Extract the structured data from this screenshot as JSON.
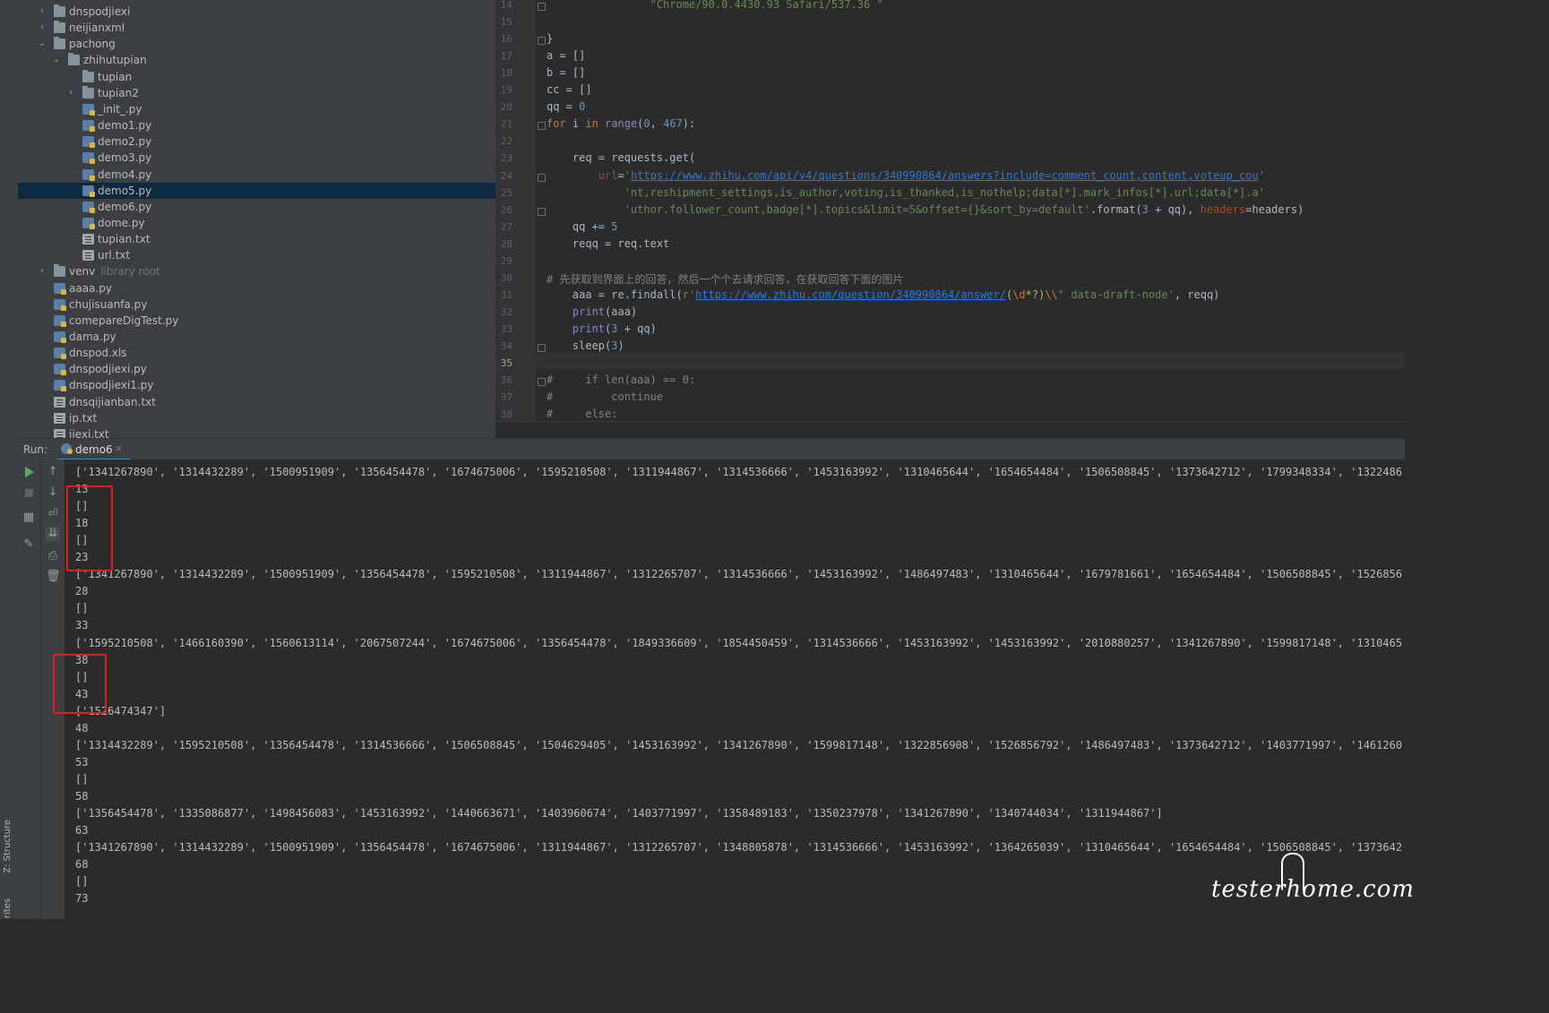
{
  "left_strip": {
    "structure_label": "Z: Structure",
    "favorites_label": "rites"
  },
  "project_tree": [
    {
      "label": "dnspodjiexi",
      "type": "folder",
      "arrow": "right",
      "muted": ""
    },
    {
      "label": "neijianxml",
      "type": "folder",
      "arrow": "right",
      "muted": ""
    },
    {
      "label": "pachong",
      "type": "folder",
      "arrow": "down",
      "muted": ""
    },
    {
      "label": "zhihutupian",
      "type": "folder",
      "arrow": "down",
      "muted": ""
    },
    {
      "label": "tupian",
      "type": "folder",
      "arrow": "",
      "muted": ""
    },
    {
      "label": "tupian2",
      "type": "folder",
      "arrow": "right",
      "muted": ""
    },
    {
      "label": "_init_.py",
      "type": "py",
      "arrow": "",
      "muted": ""
    },
    {
      "label": "demo1.py",
      "type": "py",
      "arrow": "",
      "muted": ""
    },
    {
      "label": "demo2.py",
      "type": "py",
      "arrow": "",
      "muted": ""
    },
    {
      "label": "demo3.py",
      "type": "py",
      "arrow": "",
      "muted": ""
    },
    {
      "label": "demo4.py",
      "type": "py",
      "arrow": "",
      "muted": ""
    },
    {
      "label": "demo5.py",
      "type": "py",
      "arrow": "",
      "muted": "",
      "selected": true
    },
    {
      "label": "demo6.py",
      "type": "py",
      "arrow": "",
      "muted": ""
    },
    {
      "label": "dome.py",
      "type": "py",
      "arrow": "",
      "muted": ""
    },
    {
      "label": "tupian.txt",
      "type": "txt",
      "arrow": "",
      "muted": ""
    },
    {
      "label": "url.txt",
      "type": "txt",
      "arrow": "",
      "muted": ""
    },
    {
      "label": "venv",
      "type": "folder",
      "arrow": "right",
      "muted": "library root"
    },
    {
      "label": "aaaa.py",
      "type": "py",
      "arrow": "",
      "muted": ""
    },
    {
      "label": "chujisuanfa.py",
      "type": "py",
      "arrow": "",
      "muted": ""
    },
    {
      "label": "comepareDigTest.py",
      "type": "py",
      "arrow": "",
      "muted": ""
    },
    {
      "label": "dama.py",
      "type": "py",
      "arrow": "",
      "muted": ""
    },
    {
      "label": "dnspod.xls",
      "type": "py",
      "arrow": "",
      "muted": ""
    },
    {
      "label": "dnspodjiexi.py",
      "type": "py",
      "arrow": "",
      "muted": ""
    },
    {
      "label": "dnspodjiexi1.py",
      "type": "py",
      "arrow": "",
      "muted": ""
    },
    {
      "label": "dnsqijianban.txt",
      "type": "txt",
      "arrow": "",
      "muted": ""
    },
    {
      "label": "ip.txt",
      "type": "txt",
      "arrow": "",
      "muted": ""
    },
    {
      "label": "jiexi.txt",
      "type": "txt",
      "arrow": "",
      "muted": ""
    }
  ],
  "editor": {
    "current_line": "35",
    "lines": [
      {
        "n": "14",
        "segs": [
          {
            "t": "                \"Chrome/90.0.4430.93 Safari/537.36 \"",
            "c": "str"
          }
        ]
      },
      {
        "n": "15",
        "segs": []
      },
      {
        "n": "16",
        "segs": [
          {
            "t": "}",
            "c": ""
          }
        ]
      },
      {
        "n": "17",
        "segs": [
          {
            "t": "a = []",
            "c": ""
          }
        ]
      },
      {
        "n": "18",
        "segs": [
          {
            "t": "b = []",
            "c": ""
          }
        ]
      },
      {
        "n": "19",
        "segs": [
          {
            "t": "cc = []",
            "c": ""
          }
        ]
      },
      {
        "n": "20",
        "segs": [
          {
            "t": "qq = ",
            "c": ""
          },
          {
            "t": "0",
            "c": "num"
          }
        ]
      },
      {
        "n": "21",
        "segs": [
          {
            "t": "for ",
            "c": "kw"
          },
          {
            "t": "i ",
            "c": ""
          },
          {
            "t": "in ",
            "c": "kw"
          },
          {
            "t": "range",
            "c": "fn"
          },
          {
            "t": "(",
            "c": ""
          },
          {
            "t": "0",
            "c": "num"
          },
          {
            "t": ", ",
            "c": ""
          },
          {
            "t": "467",
            "c": "num"
          },
          {
            "t": "):",
            "c": ""
          }
        ]
      },
      {
        "n": "22",
        "segs": []
      },
      {
        "n": "23",
        "segs": [
          {
            "t": "    req = requests.get(",
            "c": ""
          }
        ]
      },
      {
        "n": "24",
        "segs": [
          {
            "t": "        ",
            "c": ""
          },
          {
            "t": "url",
            "c": "param"
          },
          {
            "t": "=",
            "c": ""
          },
          {
            "t": "'",
            "c": "str"
          },
          {
            "t": "https://www.zhihu.com/api/v4/questions/340990864/answers?include=comment_count,content,voteup_cou",
            "c": "url"
          },
          {
            "t": "'",
            "c": "str"
          }
        ]
      },
      {
        "n": "25",
        "segs": [
          {
            "t": "            ",
            "c": ""
          },
          {
            "t": "'nt,reshipment_settings,is_author,voting,is_thanked,is_nothelp;data[*].mark_infos[*].url;data[*].a'",
            "c": "str"
          }
        ]
      },
      {
        "n": "26",
        "segs": [
          {
            "t": "            ",
            "c": ""
          },
          {
            "t": "'uthor.follower_count,badge[*].topics&limit=5&offset={}&sort_by=default'",
            "c": "str"
          },
          {
            "t": ".format(",
            "c": ""
          },
          {
            "t": "3",
            "c": "num"
          },
          {
            "t": " + qq), ",
            "c": ""
          },
          {
            "t": "headers",
            "c": "param"
          },
          {
            "t": "=headers)",
            "c": ""
          }
        ]
      },
      {
        "n": "27",
        "segs": [
          {
            "t": "    qq += ",
            "c": ""
          },
          {
            "t": "5",
            "c": "num"
          }
        ]
      },
      {
        "n": "28",
        "segs": [
          {
            "t": "    reqq = req.text",
            "c": ""
          }
        ]
      },
      {
        "n": "29",
        "segs": []
      },
      {
        "n": "30",
        "segs": [
          {
            "t": "# 先获取到界面上的回答，然后一个个去请求回答，在获取回答下面的图片",
            "c": "cmt"
          }
        ]
      },
      {
        "n": "31",
        "segs": [
          {
            "t": "    aaa = re.findall(",
            "c": ""
          },
          {
            "t": "r'",
            "c": "str"
          },
          {
            "t": "https://www.zhihu.com/question/340990864/answer/",
            "c": "url"
          },
          {
            "t": "(",
            "c": "esc2"
          },
          {
            "t": "\\d",
            "c": "esc"
          },
          {
            "t": "*?",
            "c": "esc2"
          },
          {
            "t": ")",
            "c": "esc2"
          },
          {
            "t": "\\\\",
            "c": "esc"
          },
          {
            "t": "\" data-draft-node'",
            "c": "str"
          },
          {
            "t": ", reqq)",
            "c": ""
          }
        ]
      },
      {
        "n": "32",
        "segs": [
          {
            "t": "    ",
            "c": ""
          },
          {
            "t": "print",
            "c": "fn"
          },
          {
            "t": "(aaa)",
            "c": ""
          }
        ]
      },
      {
        "n": "33",
        "segs": [
          {
            "t": "    ",
            "c": ""
          },
          {
            "t": "print",
            "c": "fn"
          },
          {
            "t": "(",
            "c": ""
          },
          {
            "t": "3",
            "c": "num"
          },
          {
            "t": " + qq)",
            "c": ""
          }
        ]
      },
      {
        "n": "34",
        "segs": [
          {
            "t": "    sleep(",
            "c": ""
          },
          {
            "t": "3",
            "c": "num"
          },
          {
            "t": ")",
            "c": ""
          }
        ]
      },
      {
        "n": "35",
        "segs": []
      },
      {
        "n": "36",
        "segs": [
          {
            "t": "#     if len(aaa) == 0:",
            "c": "cmt"
          }
        ]
      },
      {
        "n": "37",
        "segs": [
          {
            "t": "#         continue",
            "c": "cmt"
          }
        ]
      },
      {
        "n": "38",
        "segs": [
          {
            "t": "#     else:",
            "c": "cmt"
          }
        ]
      }
    ]
  },
  "run_panel": {
    "title": "Run:",
    "tab_label": "demo6",
    "close_glyph": "×",
    "console_lines": [
      "['1341267890', '1314432289', '1500951909', '1356454478', '1674675006', '1595210508', '1311944867', '1314536666', '1453163992', '1310465644', '1654654484', '1506508845', '1373642712', '1799348334', '1322486",
      "13",
      "[]",
      "18",
      "[]",
      "23",
      "['1341267890', '1314432289', '1500951909', '1356454478', '1595210508', '1311944867', '1312265707', '1314536666', '1453163992', '1486497483', '1310465644', '1679781661', '1654654484', '1506508845', '1526856",
      "28",
      "[]",
      "33",
      "['1595210508', '1466160390', '1560613114', '2067507244', '1674675006', '1356454478', '1849336609', '1854450459', '1314536666', '1453163992', '1453163992', '2010880257', '1341267890', '1599817148', '1310465",
      "38",
      "[]",
      "43",
      "['1526474347']",
      "48",
      "['1314432289', '1595210508', '1356454478', '1314536666', '1506508845', '1504629405', '1453163992', '1341267890', '1599817148', '1322856908', '1526856792', '1486497483', '1373642712', '1403771997', '1461260",
      "53",
      "[]",
      "58",
      "['1356454478', '1335086877', '1498456083', '1453163992', '1440663671', '1403960674', '1403771997', '1358489183', '1350237978', '1341267890', '1340744034', '1311944867']",
      "63",
      "['1341267890', '1314432289', '1500951909', '1356454478', '1674675006', '1311944867', '1312265707', '1348805878', '1314536666', '1453163992', '1364265039', '1310465644', '1654654484', '1506508845', '1373642",
      "68",
      "[]",
      "73"
    ]
  },
  "watermark": "testerhome.com",
  "colors": {
    "accent": "#4a88c7",
    "annotation": "#e01e1e",
    "selection": "#0d293e"
  }
}
